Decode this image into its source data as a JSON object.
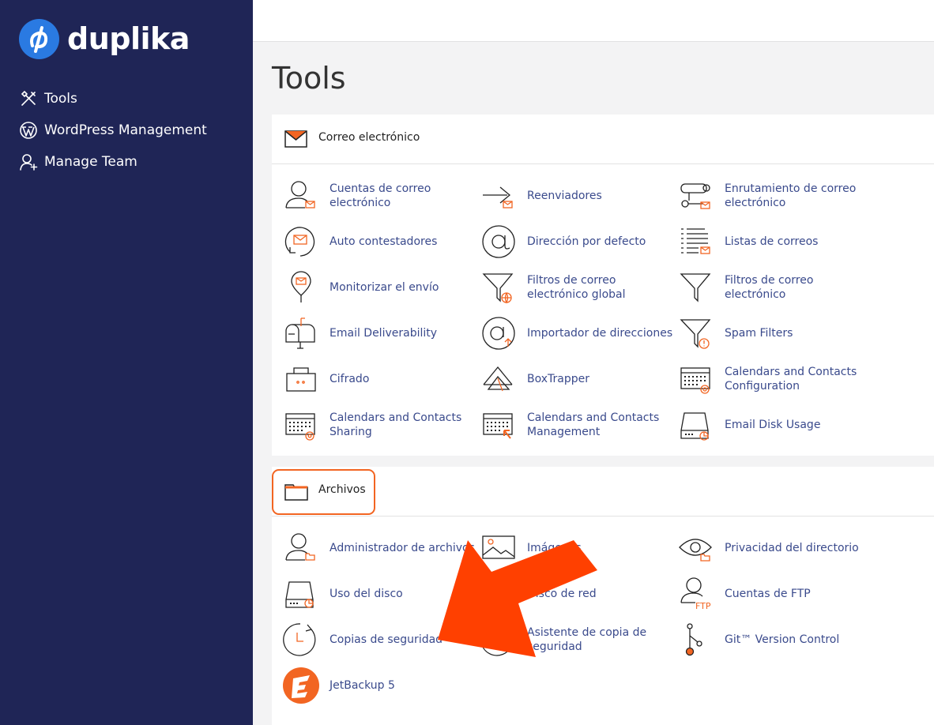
{
  "brand": {
    "name": "duplika",
    "color": "#2a7ae2"
  },
  "sidebar": {
    "items": [
      {
        "label": "Tools",
        "icon": "tools-icon"
      },
      {
        "label": "WordPress Management",
        "icon": "wordpress-icon"
      },
      {
        "label": "Manage Team",
        "icon": "user-add-icon"
      }
    ]
  },
  "page": {
    "title": "Tools"
  },
  "sections": {
    "email": {
      "title": "Correo electrónico",
      "items": [
        "Cuentas de correo electrónico",
        "Reenviadores",
        "Enrutamiento de correo electrónico",
        "Auto contestadores",
        "Dirección por defecto",
        "Listas de correos",
        "Monitorizar el envío",
        "Filtros de correo electrónico global",
        "Filtros de correo electrónico",
        "Email Deliverability",
        "Importador de direcciones",
        "Spam Filters",
        "Cifrado",
        "BoxTrapper",
        "Calendars and Contacts Configuration",
        "Calendars and Contacts Sharing",
        "Calendars and Contacts Management",
        "Email Disk Usage"
      ]
    },
    "files": {
      "title": "Archivos",
      "items": [
        "Administrador de archivos",
        "Imágenes",
        "Privacidad del directorio",
        "Uso del disco",
        "Disco de red",
        "Cuentas de FTP",
        "Copias de seguridad",
        "Asistente de copia de seguridad",
        "Git™ Version Control",
        "JetBackup 5"
      ]
    }
  },
  "colors": {
    "sidebar": "#1f2556",
    "accent": "#f26522",
    "link": "#3a4a8c",
    "arrow": "#ff4000"
  }
}
